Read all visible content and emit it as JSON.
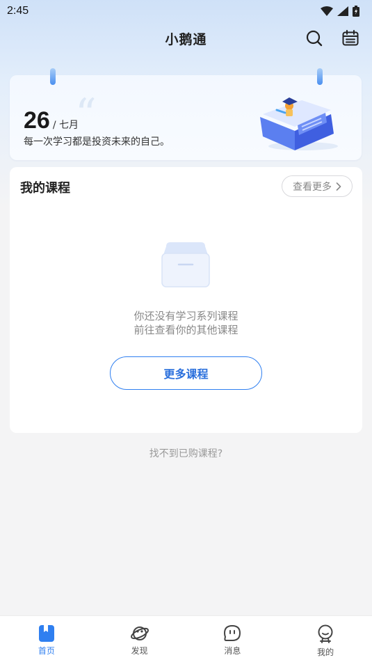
{
  "status_bar": {
    "time": "2:45",
    "icons": [
      "wifi-icon",
      "signal-icon",
      "battery-icon"
    ]
  },
  "header": {
    "title": "小鹅通",
    "icons": [
      "search-icon",
      "calendar-icon"
    ]
  },
  "date_card": {
    "day": "26",
    "month": "/ 七月",
    "quote": "每一次学习都是投资未来的自己。"
  },
  "course_section": {
    "title": "我的课程",
    "more_link": "查看更多",
    "empty_line1": "你还没有学习系列课程",
    "empty_line2": "前往查看你的其他课程",
    "more_button": "更多课程"
  },
  "not_found": "找不到已购课程?",
  "tabbar": {
    "items": [
      {
        "label": "首页",
        "icon": "home-icon",
        "active": true
      },
      {
        "label": "发现",
        "icon": "planet-icon",
        "active": false
      },
      {
        "label": "消息",
        "icon": "message-icon",
        "active": false
      },
      {
        "label": "我的",
        "icon": "profile-icon",
        "active": false
      }
    ]
  },
  "colors": {
    "accent": "#2f7ff0",
    "background": "#f4f4f5",
    "card": "#ffffff",
    "muted_text": "#888888"
  }
}
